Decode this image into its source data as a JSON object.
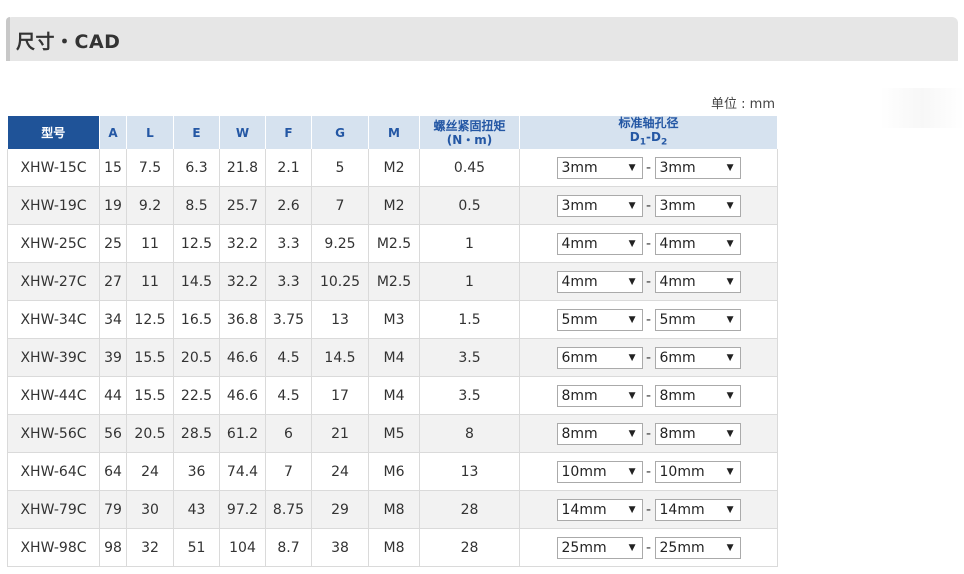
{
  "section_title": "尺寸・CAD",
  "unit_label": "单位 : mm",
  "columns": {
    "model": "型号",
    "A": "A",
    "L": "L",
    "E": "E",
    "W": "W",
    "F": "F",
    "G": "G",
    "M": "M",
    "torque_line1": "螺丝紧固扭矩",
    "torque_line2": "(N・m)",
    "bore_line1": "标准轴孔径",
    "bore_d": "D",
    "bore_sub1": "1",
    "bore_dash": "-D",
    "bore_sub2": "2"
  },
  "separator": "-",
  "rows": [
    {
      "model": "XHW-15C",
      "A": "15",
      "L": "7.5",
      "E": "6.3",
      "W": "21.8",
      "F": "2.1",
      "G": "5",
      "M": "M2",
      "torque": "0.45",
      "d1": "3mm",
      "d2": "3mm"
    },
    {
      "model": "XHW-19C",
      "A": "19",
      "L": "9.2",
      "E": "8.5",
      "W": "25.7",
      "F": "2.6",
      "G": "7",
      "M": "M2",
      "torque": "0.5",
      "d1": "3mm",
      "d2": "3mm"
    },
    {
      "model": "XHW-25C",
      "A": "25",
      "L": "11",
      "E": "12.5",
      "W": "32.2",
      "F": "3.3",
      "G": "9.25",
      "M": "M2.5",
      "torque": "1",
      "d1": "4mm",
      "d2": "4mm"
    },
    {
      "model": "XHW-27C",
      "A": "27",
      "L": "11",
      "E": "14.5",
      "W": "32.2",
      "F": "3.3",
      "G": "10.25",
      "M": "M2.5",
      "torque": "1",
      "d1": "4mm",
      "d2": "4mm"
    },
    {
      "model": "XHW-34C",
      "A": "34",
      "L": "12.5",
      "E": "16.5",
      "W": "36.8",
      "F": "3.75",
      "G": "13",
      "M": "M3",
      "torque": "1.5",
      "d1": "5mm",
      "d2": "5mm"
    },
    {
      "model": "XHW-39C",
      "A": "39",
      "L": "15.5",
      "E": "20.5",
      "W": "46.6",
      "F": "4.5",
      "G": "14.5",
      "M": "M4",
      "torque": "3.5",
      "d1": "6mm",
      "d2": "6mm"
    },
    {
      "model": "XHW-44C",
      "A": "44",
      "L": "15.5",
      "E": "22.5",
      "W": "46.6",
      "F": "4.5",
      "G": "17",
      "M": "M4",
      "torque": "3.5",
      "d1": "8mm",
      "d2": "8mm"
    },
    {
      "model": "XHW-56C",
      "A": "56",
      "L": "20.5",
      "E": "28.5",
      "W": "61.2",
      "F": "6",
      "G": "21",
      "M": "M5",
      "torque": "8",
      "d1": "8mm",
      "d2": "8mm"
    },
    {
      "model": "XHW-64C",
      "A": "64",
      "L": "24",
      "E": "36",
      "W": "74.4",
      "F": "7",
      "G": "24",
      "M": "M6",
      "torque": "13",
      "d1": "10mm",
      "d2": "10mm"
    },
    {
      "model": "XHW-79C",
      "A": "79",
      "L": "30",
      "E": "43",
      "W": "97.2",
      "F": "8.75",
      "G": "29",
      "M": "M8",
      "torque": "28",
      "d1": "14mm",
      "d2": "14mm"
    },
    {
      "model": "XHW-98C",
      "A": "98",
      "L": "32",
      "E": "51",
      "W": "104",
      "F": "8.7",
      "G": "38",
      "M": "M8",
      "torque": "28",
      "d1": "25mm",
      "d2": "25mm"
    }
  ],
  "dropdown_arrow": "▼"
}
